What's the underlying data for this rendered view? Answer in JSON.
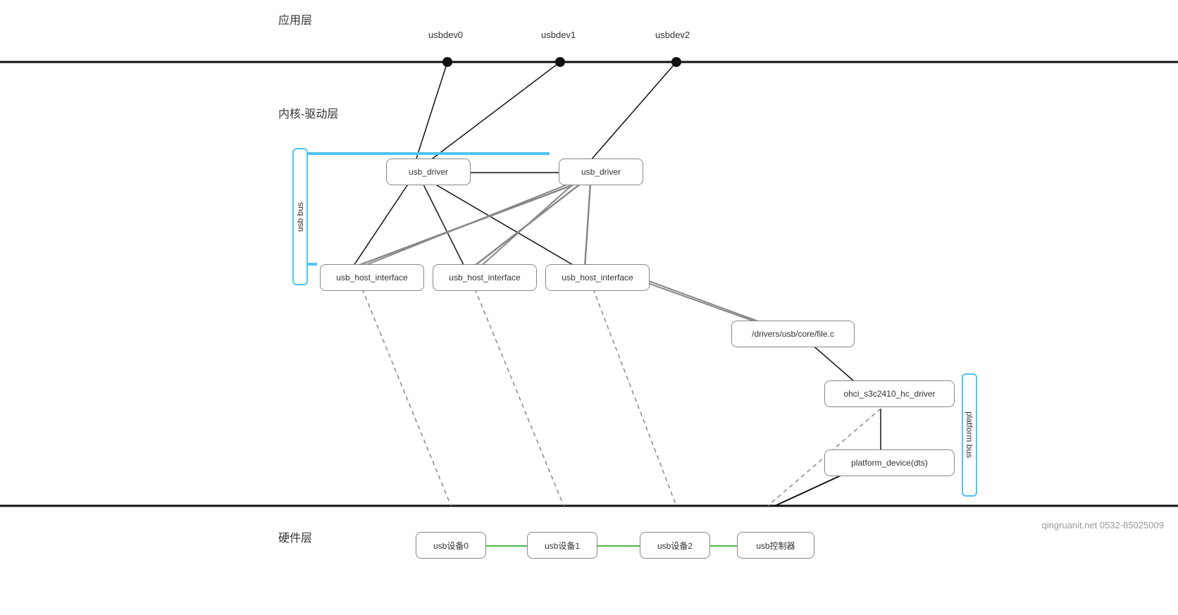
{
  "layers": {
    "app_layer": "应用层",
    "kernel_layer": "内核-驱动层",
    "hw_layer": "硬件层"
  },
  "nodes": {
    "usbdev0": "usbdev0",
    "usbdev1": "usbdev1",
    "usbdev2": "usbdev2",
    "usb_driver1": "usb_driver",
    "usb_driver2": "usb_driver",
    "usb_host_interface1": "usb_host_interface",
    "usb_host_interface2": "usb_host_interface",
    "usb_host_interface3": "usb_host_interface",
    "file_c": "/drivers/usb/core/file.c",
    "ohci_driver": "ohci_s3c2410_hc_driver",
    "platform_device": "platform_device(dts)",
    "usb_dev0": "usb设备0",
    "usb_dev1": "usb设备1",
    "usb_dev2": "usb设备2",
    "usb_controller": "usb控制器",
    "usb_bus": "usb bus",
    "platform_bus": "platform bus"
  },
  "watermark": "qingruanit.net 0532-85025009"
}
